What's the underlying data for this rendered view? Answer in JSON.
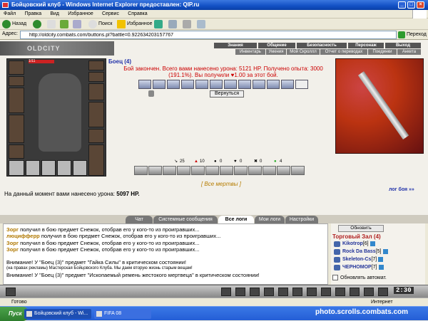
{
  "window": {
    "title": "Бойцовский клуб - Windows Internet Explorer предоставлен: QIP.ru"
  },
  "menu": [
    "Файл",
    "Правка",
    "Вид",
    "Избранное",
    "Сервис",
    "Справка"
  ],
  "toolbar": {
    "back": "Назад",
    "search": "Поиск",
    "favorites": "Избранное"
  },
  "address": {
    "label": "Адрес:",
    "url": "http://oldcity.combats.com/buttons.pl?battle=0.922634203157767",
    "go": "Переход"
  },
  "site": {
    "logo": "OLDCITY",
    "nav_top": [
      "Знания",
      "Общение",
      "Безопасность",
      "Персонаж",
      "Выход"
    ],
    "nav_bottom": [
      "Инвентарь",
      "Умения",
      "Мой Скроллл",
      "Отчет о переводах",
      "Поединки",
      "Анкета"
    ]
  },
  "character": {
    "hp": "1/11",
    "name": "Боец (4)"
  },
  "battle": {
    "result_line1": "Бой закончен. Всего вами нанесено урона: 5121 HP. Получено опыта: 3000",
    "result_line2": "(191.1%). Вы получили ♥1.00 за этот бой.",
    "return_button": "Вернуться",
    "stats": [
      "25",
      "10",
      "0",
      "0",
      "0",
      "4"
    ],
    "all_dead": "[ Все мертвы ]",
    "damage_label": "На данный момент вами нанесено урона:",
    "damage_value": "5097 HP.",
    "log_link": "лог боя »»"
  },
  "chat_tabs": [
    "Чат",
    "Системные сообщения",
    "Все логи",
    "Мои логи",
    "Настройки"
  ],
  "chat": {
    "lines": [
      {
        "nick": "Зорг",
        "text": " получил в бою предмет Снежок, отобрав его у кого-то из проигравших..."
      },
      {
        "nick": "люцифферр",
        "text": " получил в бою предмет Снежок, отобрав его у кого-то из проигравших..."
      },
      {
        "nick": "Зорг",
        "text": " получил в бою предмет Снежок, отобрав его у кого-то из проигравших..."
      },
      {
        "nick": "Зорг",
        "text": " получил в бою предмет Снежок, отобрав его у кого-то из проигравших..."
      }
    ],
    "warn1": "Внимание! У \"Боец (3)\" предмет \"Гайка Силы\" в критическом состоянии!",
    "ad": "(на правах рекламы) Мастерская Бойцовского Клуба. Мы даем вторую жизнь старым вещам!",
    "warn2": "Внимание! У \"Боец (3)\" предмет \"Ископаемый ремень жестокого мертвеца\" в критическом состоянии!"
  },
  "side": {
    "refresh": "Обновить",
    "hall_title": "Торговый Зал (4)",
    "users": [
      {
        "name": "Kikotrop",
        "level": "[6]"
      },
      {
        "name": "Rock Da Bass",
        "level": "[5]"
      },
      {
        "name": "Skeleton-Cs",
        "level": "[7]"
      },
      {
        "name": "ЧЕРНОМОР",
        "level": "[7]"
      }
    ],
    "auto_update": "Обновлять автомат."
  },
  "clock": "2:30",
  "status": {
    "ready": "Готово",
    "zone": "Интернет"
  },
  "taskbar": {
    "start": "Пуск",
    "tasks": [
      "Бойцовский клуб - Wi...",
      "FIFA 08"
    ],
    "watermark": "photo.scrolls.combats.com"
  }
}
